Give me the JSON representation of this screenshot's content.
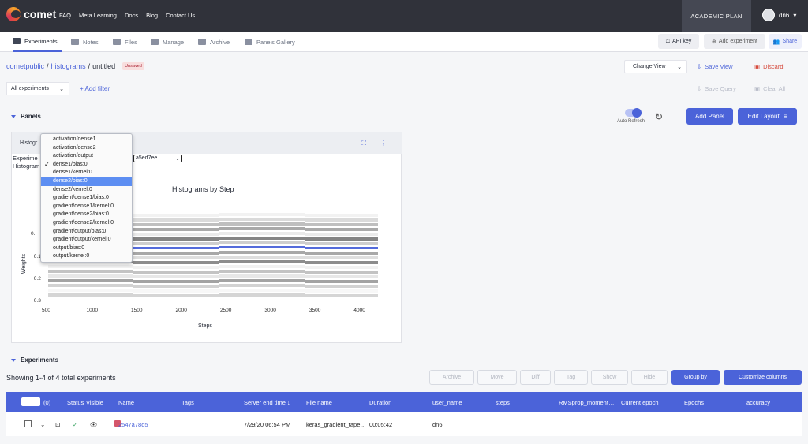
{
  "app": {
    "brand": "comet",
    "nav": [
      "FAQ",
      "Meta Learning",
      "Docs",
      "Blog",
      "Contact Us"
    ],
    "plan": "ACADEMIC PLAN",
    "user": "dn6"
  },
  "tabs": [
    {
      "label": "Experiments",
      "icon": "experiments-icon",
      "active": true
    },
    {
      "label": "Notes",
      "icon": "notes-icon"
    },
    {
      "label": "Files",
      "icon": "folder-icon"
    },
    {
      "label": "Manage",
      "icon": "manage-icon"
    },
    {
      "label": "Archive",
      "icon": "archive-icon"
    },
    {
      "label": "Panels Gallery",
      "icon": "panels-gallery-icon"
    }
  ],
  "actions": {
    "api_key": "API key",
    "add_experiment": "Add experiment",
    "share": "Share"
  },
  "breadcrumb": {
    "workspace": "cometpublic",
    "project": "histograms",
    "view": "untitled",
    "badge": "Unsaved"
  },
  "view_controls": {
    "change_view": "Change View",
    "save_view": "Save View",
    "discard": "Discard",
    "save_query": "Save Query",
    "clear_all": "Clear All"
  },
  "filters": {
    "all_experiments": "All experiments",
    "add_filter": "+ Add filter"
  },
  "panels": {
    "title": "Panels",
    "auto_refresh": "Auto Refresh",
    "add_panel": "Add Panel",
    "edit_layout": "Edit Layout"
  },
  "panel": {
    "header": "Histogr",
    "experiment_label": "Experime",
    "histogram_label": "Histogram",
    "selected_experiment": "a5ed7ee",
    "dropdown_options": [
      "activation/dense1",
      "activation/dense2",
      "activation/output",
      "dense1/bias:0",
      "dense1/kernel:0",
      "dense2/bias:0",
      "dense2/kernel:0",
      "gradient/dense1/bias:0",
      "gradient/dense1/kernel:0",
      "gradient/dense2/bias:0",
      "gradient/dense2/kernel:0",
      "gradient/output/bias:0",
      "gradient/output/kernel:0",
      "output/bias:0",
      "output/kernel:0"
    ],
    "checked_option": "dense1/bias:0",
    "highlighted_option": "dense2/bias:0"
  },
  "chart_data": {
    "type": "heatmap",
    "title": "Histograms by Step",
    "xlabel": "Steps",
    "ylabel": "Weights",
    "x_ticks": [
      500,
      1000,
      1500,
      2000,
      2500,
      3000,
      3500,
      4000
    ],
    "y_ticks": [
      "0.",
      "−0.1",
      "−0.2",
      "−0.3"
    ],
    "xlim": [
      500,
      4200
    ],
    "ylim": [
      -0.3,
      0.1
    ],
    "step_bins": [
      {
        "start": 500,
        "end": 1460
      },
      {
        "start": 1460,
        "end": 2420
      },
      {
        "start": 2420,
        "end": 3380
      },
      {
        "start": 3380,
        "end": 4200
      }
    ],
    "highlight_weight": 0.0,
    "colorscale": [
      "#ffffff",
      "#1f2430",
      "#4b63d9"
    ]
  },
  "experiments": {
    "title": "Experiments",
    "summary": "Showing 1-4 of 4 total experiments",
    "toolbar": [
      "Archive",
      "Move",
      "Diff",
      "Tag",
      "Show",
      "Hide"
    ],
    "group_by": "Group by",
    "customize": "Customize columns",
    "selected_count": "(0)",
    "columns": [
      "Status",
      "Visible",
      "Name",
      "Tags",
      "Server end time ↓",
      "File name",
      "Duration",
      "user_name",
      "steps",
      "RMSprop_moment…",
      "Current epoch",
      "Epochs",
      "accuracy"
    ],
    "rows": [
      {
        "name": "2547a78d5",
        "server_end_time": "7/29/20 06:54 PM",
        "file_name": "keras_gradient_tape…",
        "duration": "00:05:42",
        "user_name": "dn6",
        "color": "#d5566b"
      }
    ]
  }
}
